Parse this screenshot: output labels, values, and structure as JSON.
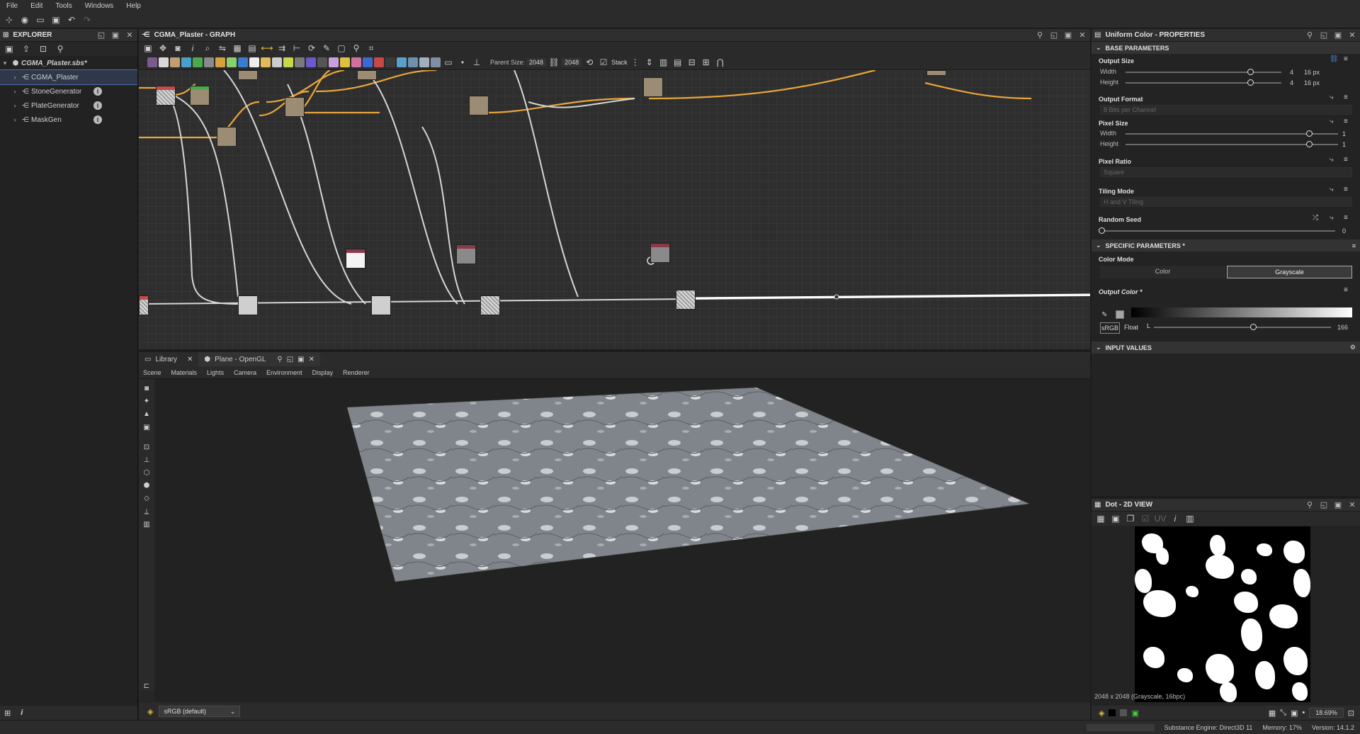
{
  "menu": [
    "File",
    "Edit",
    "Tools",
    "Windows",
    "Help"
  ],
  "explorer": {
    "title": "EXPLORER",
    "package": "CGMA_Plaster.sbs*",
    "items": [
      {
        "label": "CGMA_Plaster",
        "selected": true
      },
      {
        "label": "StoneGenerator"
      },
      {
        "label": "PlateGenerator"
      },
      {
        "label": "MaskGen"
      }
    ]
  },
  "graph": {
    "title": "CGMA_Plaster - GRAPH",
    "parent_size_label": "Parent Size:",
    "parent_size_value": "2048",
    "size_value": "2048",
    "stack_label": "Stack"
  },
  "viewport": {
    "tabs": [
      {
        "label": "Library"
      },
      {
        "label": "Plane - OpenGL"
      }
    ],
    "menu": [
      "Scene",
      "Materials",
      "Lights",
      "Camera",
      "Environment",
      "Display",
      "Renderer"
    ],
    "colorspace": "sRGB (default)"
  },
  "properties": {
    "title": "Uniform Color - PROPERTIES",
    "base_section": "BASE PARAMETERS",
    "output_size": {
      "label": "Output Size",
      "width_label": "Width",
      "height_label": "Height",
      "width_val": "4",
      "height_val": "4",
      "width_unit": "16 px",
      "height_unit": "16 px"
    },
    "output_format": {
      "label": "Output Format",
      "value": "8 Bits per Channel"
    },
    "pixel_size": {
      "label": "Pixel Size",
      "width_label": "Width",
      "height_label": "Height",
      "width_val": "1",
      "height_val": "1"
    },
    "pixel_ratio": {
      "label": "Pixel Ratio",
      "value": "Square"
    },
    "tiling_mode": {
      "label": "Tiling Mode",
      "value": "H and V Tiling"
    },
    "random_seed": {
      "label": "Random Seed",
      "value": "0"
    },
    "specific_section": "SPECIFIC PARAMETERS *",
    "color_mode": {
      "label": "Color Mode",
      "options": [
        "Color",
        "Grayscale"
      ],
      "selected": "Grayscale"
    },
    "output_color": {
      "label": "Output Color *",
      "srgb": "sRGB",
      "float": "Float",
      "channel": "L",
      "value": "166",
      "level": 0.65
    },
    "input_section": "INPUT VALUES"
  },
  "view2d": {
    "title": "Dot - 2D VIEW",
    "uv_label": "UV",
    "info": "2048 x 2048 (Grayscale, 16bpc)",
    "zoom": "18.69%"
  },
  "status": {
    "engine": "Substance Engine: Direct3D 11",
    "memory": "Memory: 17%",
    "version": "Version: 14.1.2"
  },
  "colors": {
    "wire_orange": "#e8a63a",
    "wire_white": "#d8d8d8",
    "accent": "#4b6ea8"
  }
}
